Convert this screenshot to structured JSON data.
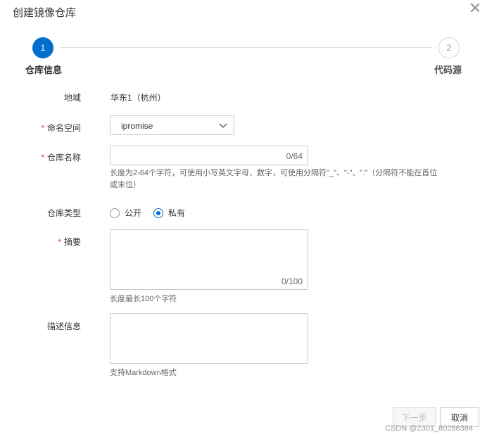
{
  "dialog": {
    "title": "创建镜像仓库"
  },
  "steps": [
    {
      "number": "1",
      "label": "仓库信息",
      "active": true
    },
    {
      "number": "2",
      "label": "代码源",
      "active": false
    }
  ],
  "form": {
    "region": {
      "label": "地域",
      "value": "华东1（杭州）"
    },
    "namespace": {
      "label": "命名空间",
      "required_mark": "*",
      "selected": "ipromise"
    },
    "repo_name": {
      "label": "仓库名称",
      "required_mark": "*",
      "value": "",
      "counter": "0/64",
      "hint": "长度为2-64个字符，可使用小写英文字母、数字，可使用分隔符\"_\"、\"-\"、\".\"（分隔符不能在首位或末位）"
    },
    "repo_type": {
      "label": "仓库类型",
      "options": [
        "公开",
        "私有"
      ],
      "selected": "私有"
    },
    "summary": {
      "label": "摘要",
      "required_mark": "*",
      "value": "",
      "counter": "0/100",
      "hint": "长度最长100个字符"
    },
    "description": {
      "label": "描述信息",
      "value": "",
      "hint": "支持Markdown格式"
    }
  },
  "footer": {
    "next_label": "下一步",
    "cancel_label": "取消"
  },
  "watermark": "CSDN @2301_80286384",
  "colors": {
    "primary": "#0070cc",
    "required": "#e0423a"
  }
}
